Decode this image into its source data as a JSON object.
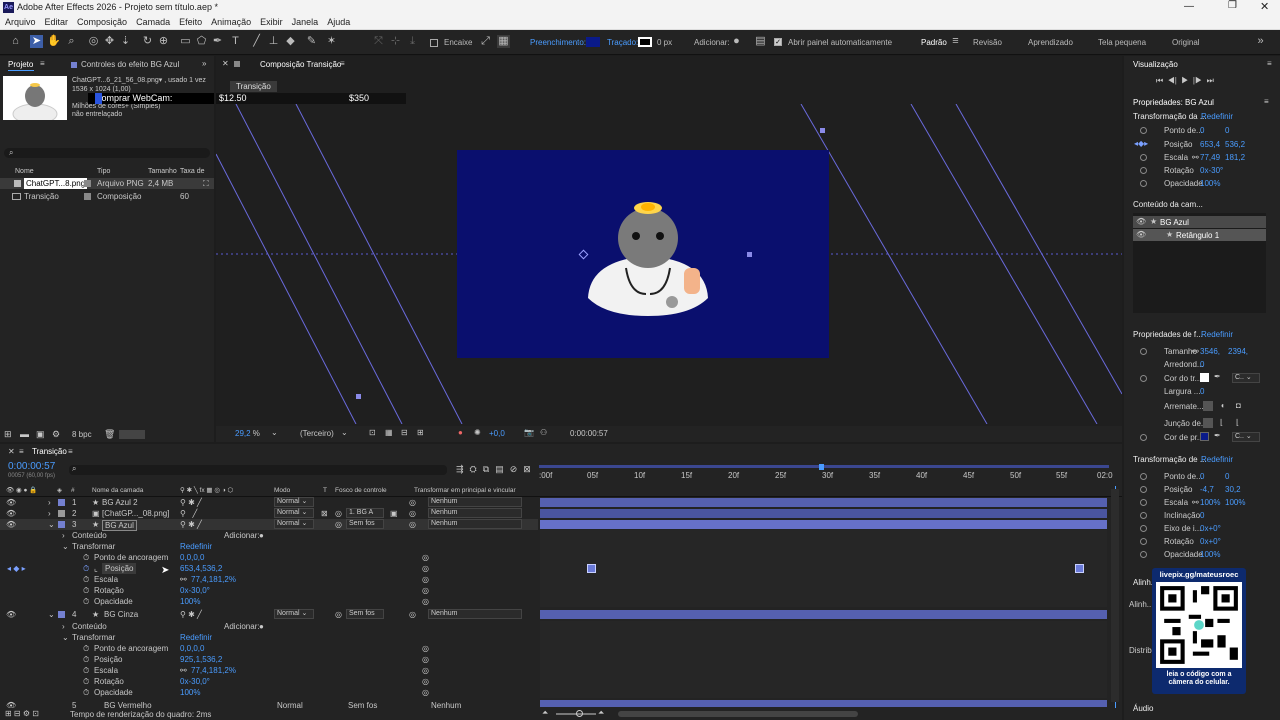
{
  "app": {
    "title": "Adobe After Effects 2026 - Projeto sem título.aep *",
    "logo": "Ae"
  },
  "menu": [
    "Arquivo",
    "Editar",
    "Composição",
    "Camada",
    "Efeito",
    "Animação",
    "Exibir",
    "Janela",
    "Ajuda"
  ],
  "toolbar": {
    "fill_label": "Preenchimento:",
    "stroke_label": "Traçado:",
    "stroke_width": "0 px",
    "add_label": "Adicionar:",
    "auto_open": "Abrir painel automaticamente",
    "snap_label": "Encaixe",
    "workspaces": [
      "Padrão",
      "Revisão",
      "Aprendizado",
      "Tela pequena",
      "Original"
    ],
    "fill_color": "#0a1a8a"
  },
  "project": {
    "tab": "Projeto",
    "effects_tab": "Controles do efeito BG Azul",
    "file_name": "ChatGPT...6_21_56_08.png▾ , usado 1 vez",
    "file_dims": "1536 x 1024 (1,00)",
    "file_colors": "Milhões de cores+ (Simples)",
    "file_interlace": "não entrelaçado",
    "overlay_label": "Comprar WebCam:",
    "search_placeholder": "",
    "columns": [
      "Nome",
      "Tipo",
      "Tamanho",
      "Taxa de"
    ],
    "items": [
      {
        "name": "ChatGPT...8.png",
        "type": "Arquivo PNG",
        "size": "2,4 MB",
        "rate": ""
      },
      {
        "name": "Transição",
        "type": "Composição",
        "size": "",
        "rate": "60"
      }
    ],
    "bpc": "8 bpc"
  },
  "composition": {
    "tab": "Composição Transição",
    "sub_tab": "Transição",
    "price_left": "$12.50",
    "price_right": "$350",
    "zoom": "29,2",
    "resolution": "(Terceiro)",
    "timecode": "0:00:00:57",
    "exposure": "+0,0",
    "bg_color": "#0a0f6e"
  },
  "timeline": {
    "tab": "Transição",
    "timecode": "0:00:00:57",
    "frames": "00057 (60,00 fps)",
    "col_headers": [
      "#",
      "Nome da camada",
      "Modo",
      "T",
      "Fosco de controle",
      "Transformar em principal e vincular"
    ],
    "ticks": [
      ":00f",
      "05f",
      "10f",
      "15f",
      "20f",
      "25f",
      "30f",
      "35f",
      "40f",
      "45f",
      "50f",
      "55f",
      "02:0"
    ],
    "layers": [
      {
        "n": "1",
        "name": "BG Azul 2",
        "mode": "Normal",
        "matte": "",
        "parent": "Nenhum"
      },
      {
        "n": "2",
        "name": "[ChatGP..._08.png]",
        "mode": "Normal",
        "matte": "1. BG A",
        "parent": "Nenhum"
      },
      {
        "n": "3",
        "name": "BG Azul",
        "mode": "Normal",
        "matte": "Sem fos",
        "parent": "Nenhum"
      },
      {
        "n": "4",
        "name": "BG Cinza",
        "mode": "Normal",
        "matte": "Sem fos",
        "parent": "Nenhum"
      },
      {
        "n": "5",
        "name": "BG Vermelho",
        "mode": "Normal",
        "matte": "Sem fos",
        "parent": "Nenhum"
      }
    ],
    "props3": {
      "content": "Conteúdo",
      "add": "Adicionar:",
      "transform": "Transformar",
      "reset": "Redefinir",
      "anchor": "Ponto de ancoragem",
      "anchor_v": "0,0,0,0",
      "position": "Posição",
      "position_v": "653,4,536,2",
      "scale": "Escala",
      "scale_v": "77,4,181,2%",
      "rotation": "Rotação",
      "rotation_v": "0x-30,0°",
      "opacity": "Opacidade",
      "opacity_v": "100%"
    },
    "props4": {
      "anchor_v": "0,0,0,0",
      "position_v": "925,1,536,2",
      "scale_v": "77,4,181,2%",
      "rotation_v": "0x-30,0°",
      "opacity_v": "100%"
    },
    "render_time": "Tempo de renderização do quadro: 2ms"
  },
  "right": {
    "viz": "Visualização",
    "props_title": "Propriedades: BG Azul",
    "transform": "Transformação da ...",
    "reset": "Redefinir",
    "t1": [
      {
        "k": "Ponto de...",
        "a": "0",
        "b": "0"
      },
      {
        "k": "Posição",
        "a": "653,4",
        "b": "536,2"
      },
      {
        "k": "Escala",
        "a": "77,49",
        "b": "181,2"
      },
      {
        "k": "Rotação",
        "a": "0x-30°",
        "b": ""
      },
      {
        "k": "Opacidade",
        "a": "100%",
        "b": ""
      }
    ],
    "content_title": "Conteúdo da cam...",
    "content_items": [
      "BG Azul",
      "Retângulo 1"
    ],
    "shape_title": "Propriedades de f...",
    "shape": [
      {
        "k": "Tamanho",
        "a": "3546,",
        "b": "2394,"
      },
      {
        "k": "Arredond...",
        "a": "0",
        "b": ""
      },
      {
        "k": "Cor do tr...",
        "a": "",
        "b": ""
      },
      {
        "k": "Largura ...",
        "a": "0",
        "b": ""
      },
      {
        "k": "Arremate...",
        "a": "",
        "b": ""
      },
      {
        "k": "Junção de...",
        "a": "",
        "b": ""
      },
      {
        "k": "Cor de pr...",
        "a": "",
        "b": ""
      }
    ],
    "t2_title": "Transformação de ...",
    "t2": [
      {
        "k": "Ponto de...",
        "a": "0",
        "b": "0"
      },
      {
        "k": "Posição",
        "a": "-4,7",
        "b": "30,2"
      },
      {
        "k": "Escala",
        "a": "100%",
        "b": "100%"
      },
      {
        "k": "Inclinação",
        "a": "0",
        "b": ""
      },
      {
        "k": "Eixo de i...",
        "a": "0x+0°",
        "b": ""
      },
      {
        "k": "Rotação",
        "a": "0x+0°",
        "b": ""
      },
      {
        "k": "Opacidade",
        "a": "100%",
        "b": ""
      }
    ],
    "align": "Alinh...",
    "distrib": "Distrib",
    "audio": "Áudio",
    "qr_top": "livepix.gg/mateusroec",
    "qr_bottom": "leia o código com a câmera do celular."
  }
}
